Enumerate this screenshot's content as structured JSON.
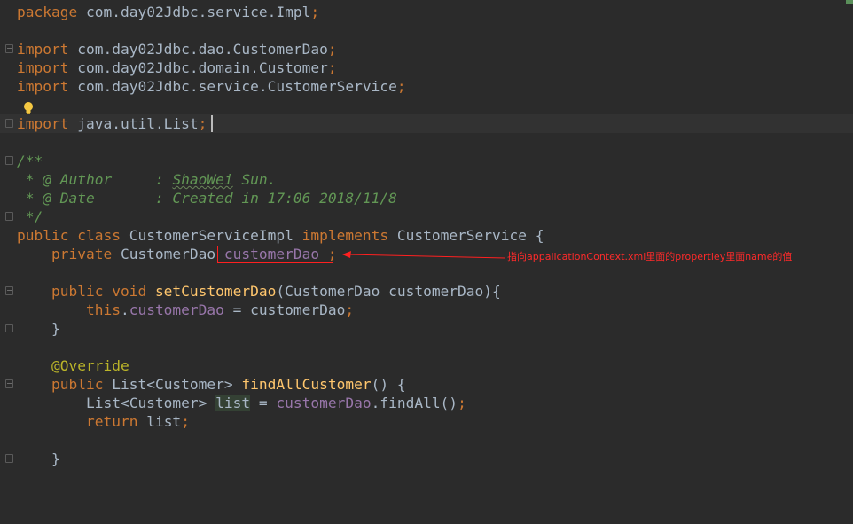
{
  "editor": {
    "lines": {
      "l1": {
        "kw": "package",
        "rest": " com.day02Jdbc.service.Impl",
        "semi": ";"
      },
      "l3": {
        "kw": "import",
        "rest": " com.day02Jdbc.dao.CustomerDao",
        "semi": ";"
      },
      "l4": {
        "kw": "import",
        "rest": " com.day02Jdbc.domain.Customer",
        "semi": ";"
      },
      "l5": {
        "kw": "import",
        "rest": " com.day02Jdbc.service.CustomerService",
        "semi": ";"
      },
      "l7": {
        "kw": "import",
        "rest": " java.util.List",
        "semi": ";"
      },
      "l9": {
        "text": "/**"
      },
      "l10": {
        "prefix": " * @ Author     : ",
        "name": "ShaoWei",
        "suffix": " Sun."
      },
      "l11": {
        "text": " * @ Date       : Created in 17:06 2018/11/8"
      },
      "l12": {
        "text": " */"
      },
      "l13": {
        "kw1": "public class",
        "name": " CustomerServiceImpl ",
        "kw2": "implements",
        "rest": " CustomerService {"
      },
      "l14": {
        "kw": "    private",
        "type": " CustomerDao ",
        "field": "customerDao",
        "semi": " ;"
      },
      "l16": {
        "kw": "    public void ",
        "method": "setCustomerDao",
        "rest": "(CustomerDao customerDao){"
      },
      "l17": {
        "kw": "        this",
        "dot": ".",
        "field": "customerDao",
        "rest": " = customerDao",
        "semi": ";"
      },
      "l18": {
        "text": "    }"
      },
      "l20": {
        "ann": "    @Override"
      },
      "l21": {
        "kw": "    public",
        "type": " List<Customer> ",
        "method": "findAllCustomer",
        "rest": "() {"
      },
      "l22": {
        "type": "        List<Customer> ",
        "var": "list",
        "eq": " = ",
        "field": "customerDao",
        "rest": ".findAll()",
        "semi": ";"
      },
      "l23": {
        "kw": "        return",
        "rest": " list",
        "semi": ";"
      },
      "l25": {
        "text": "    }"
      }
    }
  },
  "annotation": {
    "text": "指向appalicationContext.xml里面的propertiey里面name的值",
    "color": "#ff2a2a"
  },
  "colors": {
    "background": "#2b2b2b",
    "keyword": "#cc7832",
    "field": "#9876aa",
    "method": "#ffc66d",
    "annotation": "#bbb529",
    "doc_comment": "#629755"
  },
  "icons": {
    "intention": "lightbulb-icon",
    "fold": "fold-marker-icon"
  }
}
